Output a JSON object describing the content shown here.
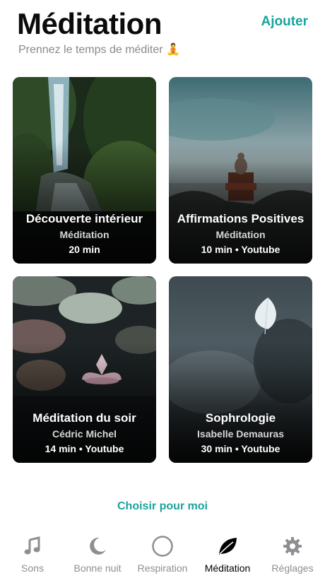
{
  "header": {
    "title": "Méditation",
    "subtitle": "Prennez le temps de méditer 🧘",
    "add_label": "Ajouter"
  },
  "cards": [
    {
      "title": "Découverte intérieur",
      "subtitle": "Méditation",
      "meta": "20 min"
    },
    {
      "title": "Affirmations Positives",
      "subtitle": "Méditation",
      "meta": "10 min • Youtube"
    },
    {
      "title": "Méditation du soir",
      "subtitle": "Cédric Michel",
      "meta": "14 min • Youtube"
    },
    {
      "title": "Sophrologie",
      "subtitle": "Isabelle Demauras",
      "meta": "30 min • Youtube"
    }
  ],
  "choose_label": "Choisir pour moi",
  "tabs": [
    {
      "label": "Sons",
      "icon": "music-note-icon"
    },
    {
      "label": "Bonne nuit",
      "icon": "moon-icon"
    },
    {
      "label": "Respiration",
      "icon": "circle-icon"
    },
    {
      "label": "Méditation",
      "icon": "leaf-icon",
      "active": true
    },
    {
      "label": "Réglages",
      "icon": "gear-icon"
    }
  ],
  "colors": {
    "accent": "#1aa39a",
    "inactive": "#8e8e93",
    "active": "#000000"
  }
}
